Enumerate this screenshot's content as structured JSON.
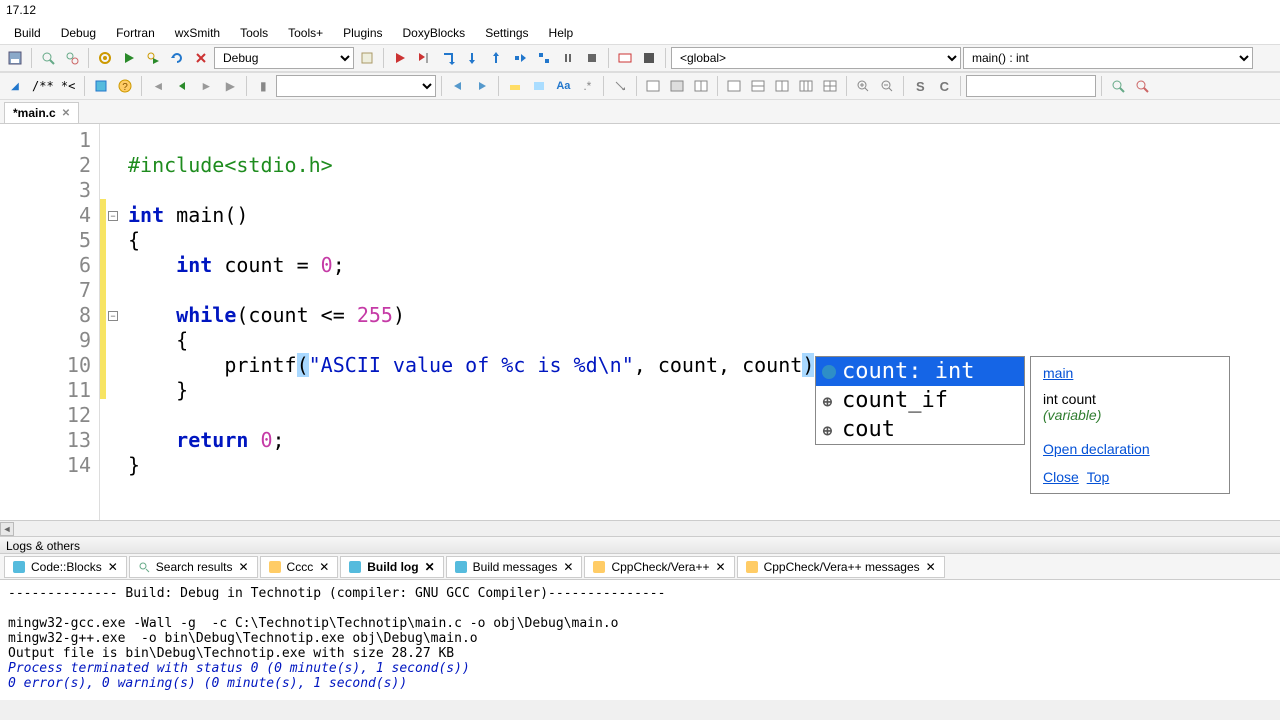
{
  "window": {
    "title": "17.12"
  },
  "menu": [
    "Build",
    "Debug",
    "Fortran",
    "wxSmith",
    "Tools",
    "Tools+",
    "Plugins",
    "DoxyBlocks",
    "Settings",
    "Help"
  ],
  "toolbar1": {
    "build_target": "Debug",
    "scope_combo": "<global>",
    "symbol_combo": "main() : int"
  },
  "toolbar2": {
    "comment_combo": " /**  *<  ",
    "search_combo": ""
  },
  "tab": {
    "name": "*main.c"
  },
  "code": {
    "lines": [
      1,
      2,
      3,
      4,
      5,
      6,
      7,
      8,
      9,
      10,
      11,
      12,
      13,
      14
    ],
    "l1_include": "#include",
    "l1_header": "<stdio.h>",
    "l3_int": "int",
    "l3_main": " main()",
    "l4": "{",
    "l5_int": "int",
    "l5_rest": " count = ",
    "l5_num": "0",
    "l5_semi": ";",
    "l7_while": "while",
    "l7_open": "(count <= ",
    "l7_num": "255",
    "l7_close": ")",
    "l8": "{",
    "l9_printf": "printf",
    "l9_p1": "(",
    "l9_str": "\"ASCII value of %c is %d\\n\"",
    "l9_args": ", count, count",
    "l9_p2": ")",
    "l10": "}",
    "l12_return": "return",
    "l12_sp": " ",
    "l12_num": "0",
    "l12_semi": ";",
    "l13": "}"
  },
  "autocomplete": {
    "items": [
      {
        "label": "count: int",
        "kind": "var",
        "selected": true
      },
      {
        "label": "count_if",
        "kind": "cpp",
        "selected": false
      },
      {
        "label": "cout",
        "kind": "cpp",
        "selected": false
      }
    ]
  },
  "tooltip": {
    "link_main": "main",
    "decl": "int count",
    "kind": "(variable)",
    "link_open": "Open declaration",
    "link_close": "Close",
    "link_top": "Top"
  },
  "logs": {
    "header": "Logs & others",
    "tabs": [
      "Code::Blocks",
      "Search results",
      "Cccc",
      "Build log",
      "Build messages",
      "CppCheck/Vera++",
      "CppCheck/Vera++ messages"
    ],
    "active_tab": "Build log",
    "lines": [
      "-------------- Build: Debug in Technotip (compiler: GNU GCC Compiler)---------------",
      "",
      "mingw32-gcc.exe -Wall -g  -c C:\\Technotip\\Technotip\\main.c -o obj\\Debug\\main.o",
      "mingw32-g++.exe  -o bin\\Debug\\Technotip.exe obj\\Debug\\main.o",
      "Output file is bin\\Debug\\Technotip.exe with size 28.27 KB"
    ],
    "blue_lines": [
      "Process terminated with status 0 (0 minute(s), 1 second(s))",
      "0 error(s), 0 warning(s) (0 minute(s), 1 second(s))"
    ]
  }
}
